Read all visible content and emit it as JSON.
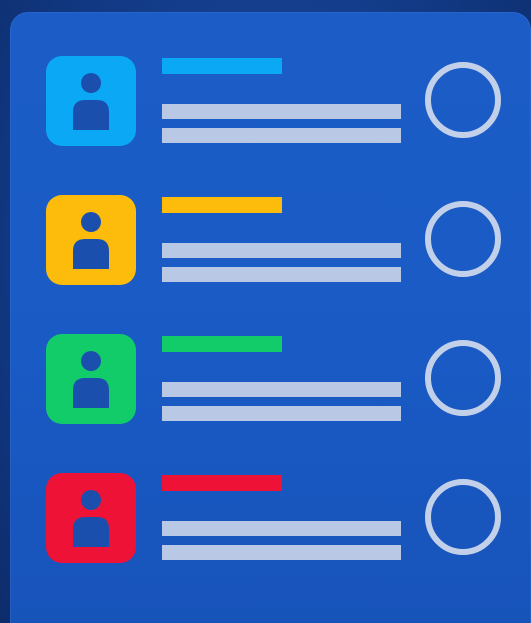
{
  "items": [
    {
      "name": "contact-1",
      "accent": "#0aa8f5",
      "checked": false,
      "icon": "person-icon"
    },
    {
      "name": "contact-2",
      "accent": "#fdbb0c",
      "checked": false,
      "icon": "person-icon"
    },
    {
      "name": "contact-3",
      "accent": "#12cc6a",
      "checked": false,
      "icon": "person-icon"
    },
    {
      "name": "contact-4",
      "accent": "#ee1236",
      "checked": false,
      "icon": "person-icon"
    }
  ],
  "colors": {
    "background": "#123a86",
    "panel": "#1b5cc7",
    "placeholder_line": "#b9c8e4",
    "radio_ring": "#c3d0ea",
    "person_glyph": "#1a4fae"
  }
}
